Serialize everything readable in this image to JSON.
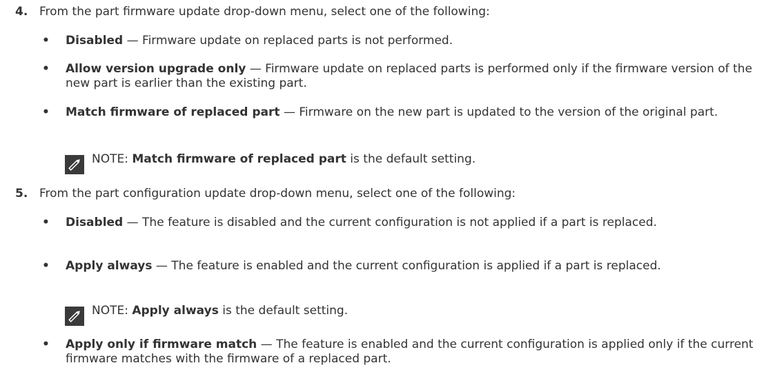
{
  "step4": {
    "number": "4.",
    "text": "From the part firmware update drop-down menu, select one of the following:",
    "bullets": [
      {
        "term": "Disabled",
        "sep": " — ",
        "desc": "Firmware update on replaced parts is not performed."
      },
      {
        "term": "Allow version upgrade only",
        "sep": " — ",
        "desc": "Firmware update on replaced parts is performed only if the firmware version of the new part is earlier than the existing part."
      },
      {
        "term": "Match firmware of replaced part",
        "sep": " — ",
        "desc": "Firmware on the new part is updated to the version of the original part."
      }
    ],
    "note": {
      "prefix": "NOTE: ",
      "term": "Match firmware of replaced part",
      "rest": " is the default setting.",
      "icon": "pencil-note-icon"
    }
  },
  "step5": {
    "number": "5.",
    "text": "From the part configuration update drop-down menu, select one of the following:",
    "bullets": [
      {
        "term": "Disabled",
        "sep": " — ",
        "desc": "The feature is disabled and the current configuration is not applied if a part is replaced."
      },
      {
        "term": "Apply always",
        "sep": " — ",
        "desc": "The feature is enabled and the current configuration is applied if a part is replaced."
      },
      {
        "term": "Apply only if firmware match",
        "sep": " — ",
        "desc": "The feature is enabled and the current configuration is applied only if the current firmware matches with the firmware of a replaced part."
      }
    ],
    "note": {
      "prefix": "NOTE: ",
      "term": "Apply always",
      "rest": " is the default setting.",
      "icon": "pencil-note-icon"
    }
  },
  "bullet_glyph": "•",
  "colors": {
    "text": "#333333",
    "icon": "#3a3a3a"
  }
}
